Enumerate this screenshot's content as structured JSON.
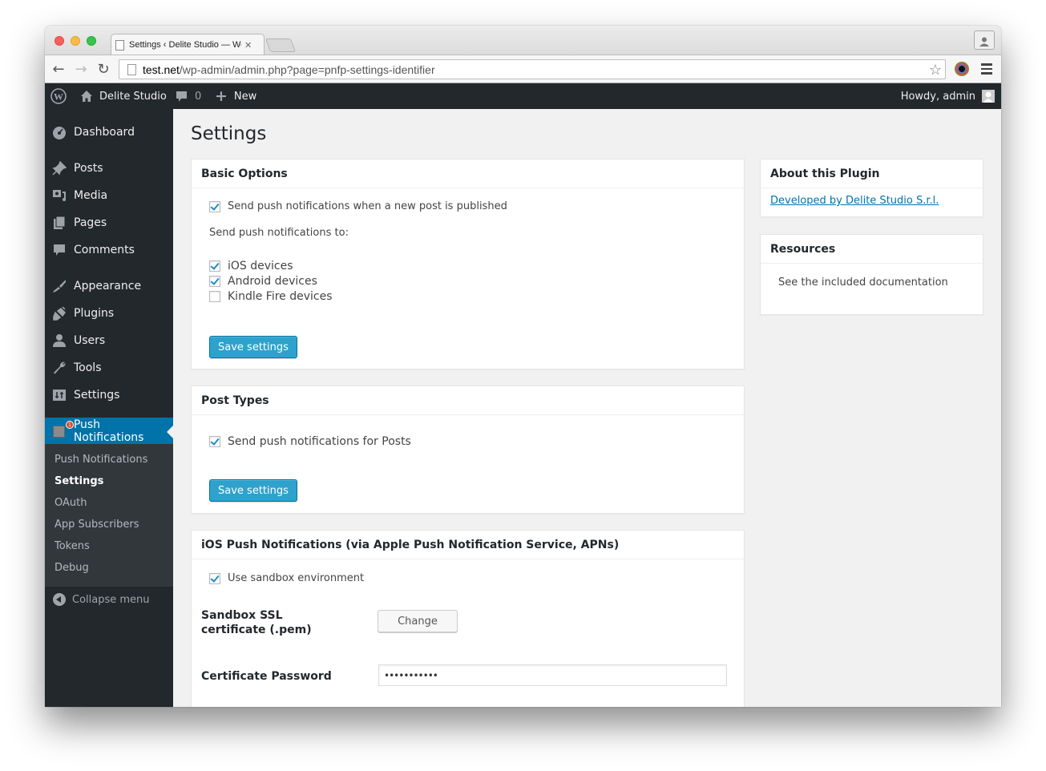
{
  "browser": {
    "tab_title": "Settings ‹ Delite Studio — WordPress",
    "url_host": "test.net",
    "url_path": "/wp-admin/admin.php?page=pnfp-settings-identifier"
  },
  "adminbar": {
    "site_name": "Delite Studio",
    "comments_count": "0",
    "new_label": "New",
    "greeting": "Howdy, admin"
  },
  "sidebar": {
    "items": [
      {
        "label": "Dashboard",
        "icon": "dashboard-icon"
      },
      {
        "label": "Posts",
        "icon": "pin-icon"
      },
      {
        "label": "Media",
        "icon": "media-icon"
      },
      {
        "label": "Pages",
        "icon": "pages-icon"
      },
      {
        "label": "Comments",
        "icon": "comment-icon"
      },
      {
        "label": "Appearance",
        "icon": "paintbrush-icon"
      },
      {
        "label": "Plugins",
        "icon": "plugin-icon"
      },
      {
        "label": "Users",
        "icon": "user-icon"
      },
      {
        "label": "Tools",
        "icon": "wrench-icon"
      },
      {
        "label": "Settings",
        "icon": "settings-icon"
      },
      {
        "label": "Push Notifications",
        "icon": "push-notifications-icon",
        "badge": "1"
      }
    ],
    "submenu": [
      {
        "label": "Push Notifications"
      },
      {
        "label": "Settings",
        "current": true
      },
      {
        "label": "OAuth"
      },
      {
        "label": "App Subscribers"
      },
      {
        "label": "Tokens"
      },
      {
        "label": "Debug"
      }
    ],
    "collapse_label": "Collapse menu"
  },
  "page": {
    "title": "Settings"
  },
  "basic_options": {
    "title": "Basic Options",
    "send_on_publish": {
      "label": "Send push notifications when a new post is published",
      "checked": true
    },
    "send_to_label": "Send push notifications to:",
    "devices": [
      {
        "label": "iOS devices",
        "checked": true
      },
      {
        "label": "Android devices",
        "checked": true
      },
      {
        "label": "Kindle Fire devices",
        "checked": false
      }
    ],
    "save_label": "Save settings"
  },
  "post_types": {
    "title": "Post Types",
    "posts": {
      "label": "Send push notifications for Posts",
      "checked": true
    },
    "save_label": "Save settings"
  },
  "ios": {
    "title": "iOS Push Notifications (via Apple Push Notification Service, APNs)",
    "sandbox": {
      "label": "Use sandbox environment",
      "checked": true
    },
    "cert_label": "Sandbox SSL certificate (.pem)",
    "change_label": "Change",
    "password_label": "Certificate Password",
    "password_value": "•••••••••••"
  },
  "about": {
    "title": "About this Plugin",
    "link_text": "Developed by Delite Studio S.r.l."
  },
  "resources": {
    "title": "Resources",
    "text": "See the included documentation"
  },
  "colors": {
    "accent": "#0073aa",
    "button_primary": "#2ea2cc",
    "adminbar_bg": "#23282d"
  }
}
